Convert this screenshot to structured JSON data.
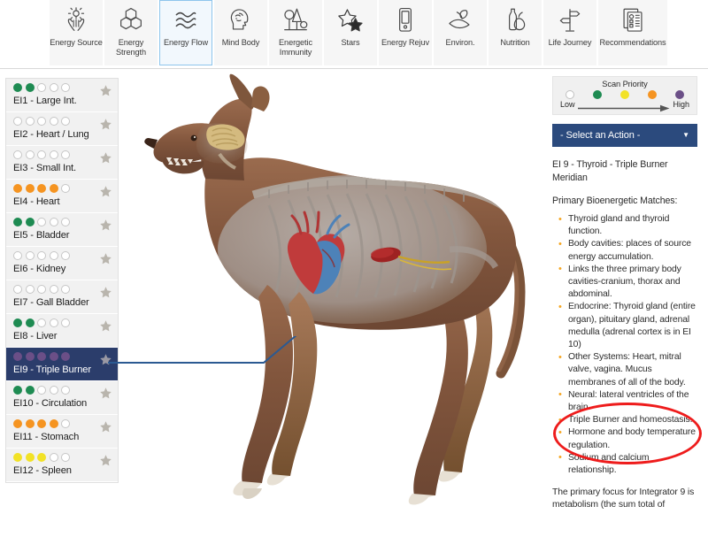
{
  "toolbar": {
    "items": [
      {
        "label": "Energy Source",
        "icon": "hands-sun-icon",
        "active": false
      },
      {
        "label": "Energy\nStrength",
        "icon": "hexagons-icon",
        "active": false
      },
      {
        "label": "Energy Flow",
        "icon": "waves-icon",
        "active": true
      },
      {
        "label": "Mind Body",
        "icon": "head-brain-icon",
        "active": false
      },
      {
        "label": "Energetic\nImmunity",
        "icon": "trees-icon",
        "active": false
      },
      {
        "label": "Stars",
        "icon": "two-stars-icon",
        "active": false
      },
      {
        "label": "Energy Rejuv",
        "icon": "device-icon",
        "active": false
      },
      {
        "label": "Environ.",
        "icon": "hand-sprout-icon",
        "active": false
      },
      {
        "label": "Nutrition",
        "icon": "bottle-pear-icon",
        "active": false
      },
      {
        "label": "Life Journey",
        "icon": "signpost-icon",
        "active": false
      },
      {
        "label": "Recommendations",
        "icon": "documents-icon",
        "active": false
      }
    ]
  },
  "sidebar": {
    "items": [
      {
        "label": "EI1 - Large Int.",
        "filled": 2,
        "color": "#1e8b52",
        "selected": false
      },
      {
        "label": "EI2 - Heart / Lung",
        "filled": 0,
        "color": "#1e8b52",
        "selected": false
      },
      {
        "label": "EI3 - Small Int.",
        "filled": 0,
        "color": "#1e8b52",
        "selected": false
      },
      {
        "label": "EI4 - Heart",
        "filled": 4,
        "color": "#f59421",
        "selected": false
      },
      {
        "label": "EI5 - Bladder",
        "filled": 2,
        "color": "#1e8b52",
        "selected": false
      },
      {
        "label": "EI6 - Kidney",
        "filled": 0,
        "color": "#1e8b52",
        "selected": false
      },
      {
        "label": "EI7 - Gall Bladder",
        "filled": 0,
        "color": "#1e8b52",
        "selected": false
      },
      {
        "label": "EI8 - Liver",
        "filled": 2,
        "color": "#1e8b52",
        "selected": false
      },
      {
        "label": "EI9 - Triple Burner",
        "filled": 5,
        "color": "#6b4f87",
        "selected": true
      },
      {
        "label": "EI10 - Circulation",
        "filled": 2,
        "color": "#1e8b52",
        "selected": false
      },
      {
        "label": "EI11 - Stomach",
        "filled": 4,
        "color": "#f59421",
        "selected": false
      },
      {
        "label": "EI12 - Spleen",
        "filled": 3,
        "color": "#f2e226",
        "selected": false
      }
    ],
    "dots_per_row": 5,
    "star_icon": "star-icon"
  },
  "legend": {
    "title": "Scan Priority",
    "low_label": "Low",
    "high_label": "High",
    "colors": [
      "#ffffff",
      "#1e8b52",
      "#f2e226",
      "#f59421",
      "#6b4f87"
    ]
  },
  "action": {
    "label": "- Select an Action -",
    "caret_icon": "chevron-down-icon"
  },
  "detail": {
    "title": "EI 9 - Thyroid - Triple Burner Meridian",
    "subtitle": "Primary Bioenergetic Matches:",
    "matches": [
      "Thyroid gland and thyroid function.",
      "Body cavities: places of source energy accumulation.",
      "Links the three primary body cavities-cranium, thorax and abdominal.",
      "Endocrine: Thyroid gland (entire organ), pituitary gland, adrenal medulla (adrenal cortex is in EI 10)",
      "Other Systems: Heart, mitral valve, vagina. Mucus membranes of all of the body.",
      "Neural: lateral ventricles of the brain.",
      "Triple Burner and homeostasis.",
      "Hormone and body temperature regulation.",
      "Sodium and calcium relationship."
    ],
    "footer": "The primary focus for Integrator 9 is metabolism (the sum total of"
  },
  "annotation": {
    "shape": "red-ellipse-highlight",
    "color": "#ee1c1c"
  },
  "canvas": {
    "subject": "dog-anatomy-model",
    "highlight": "heart-organ",
    "connector": "ei9-to-heart-leader-line",
    "connector_color": "#2b5a92"
  }
}
